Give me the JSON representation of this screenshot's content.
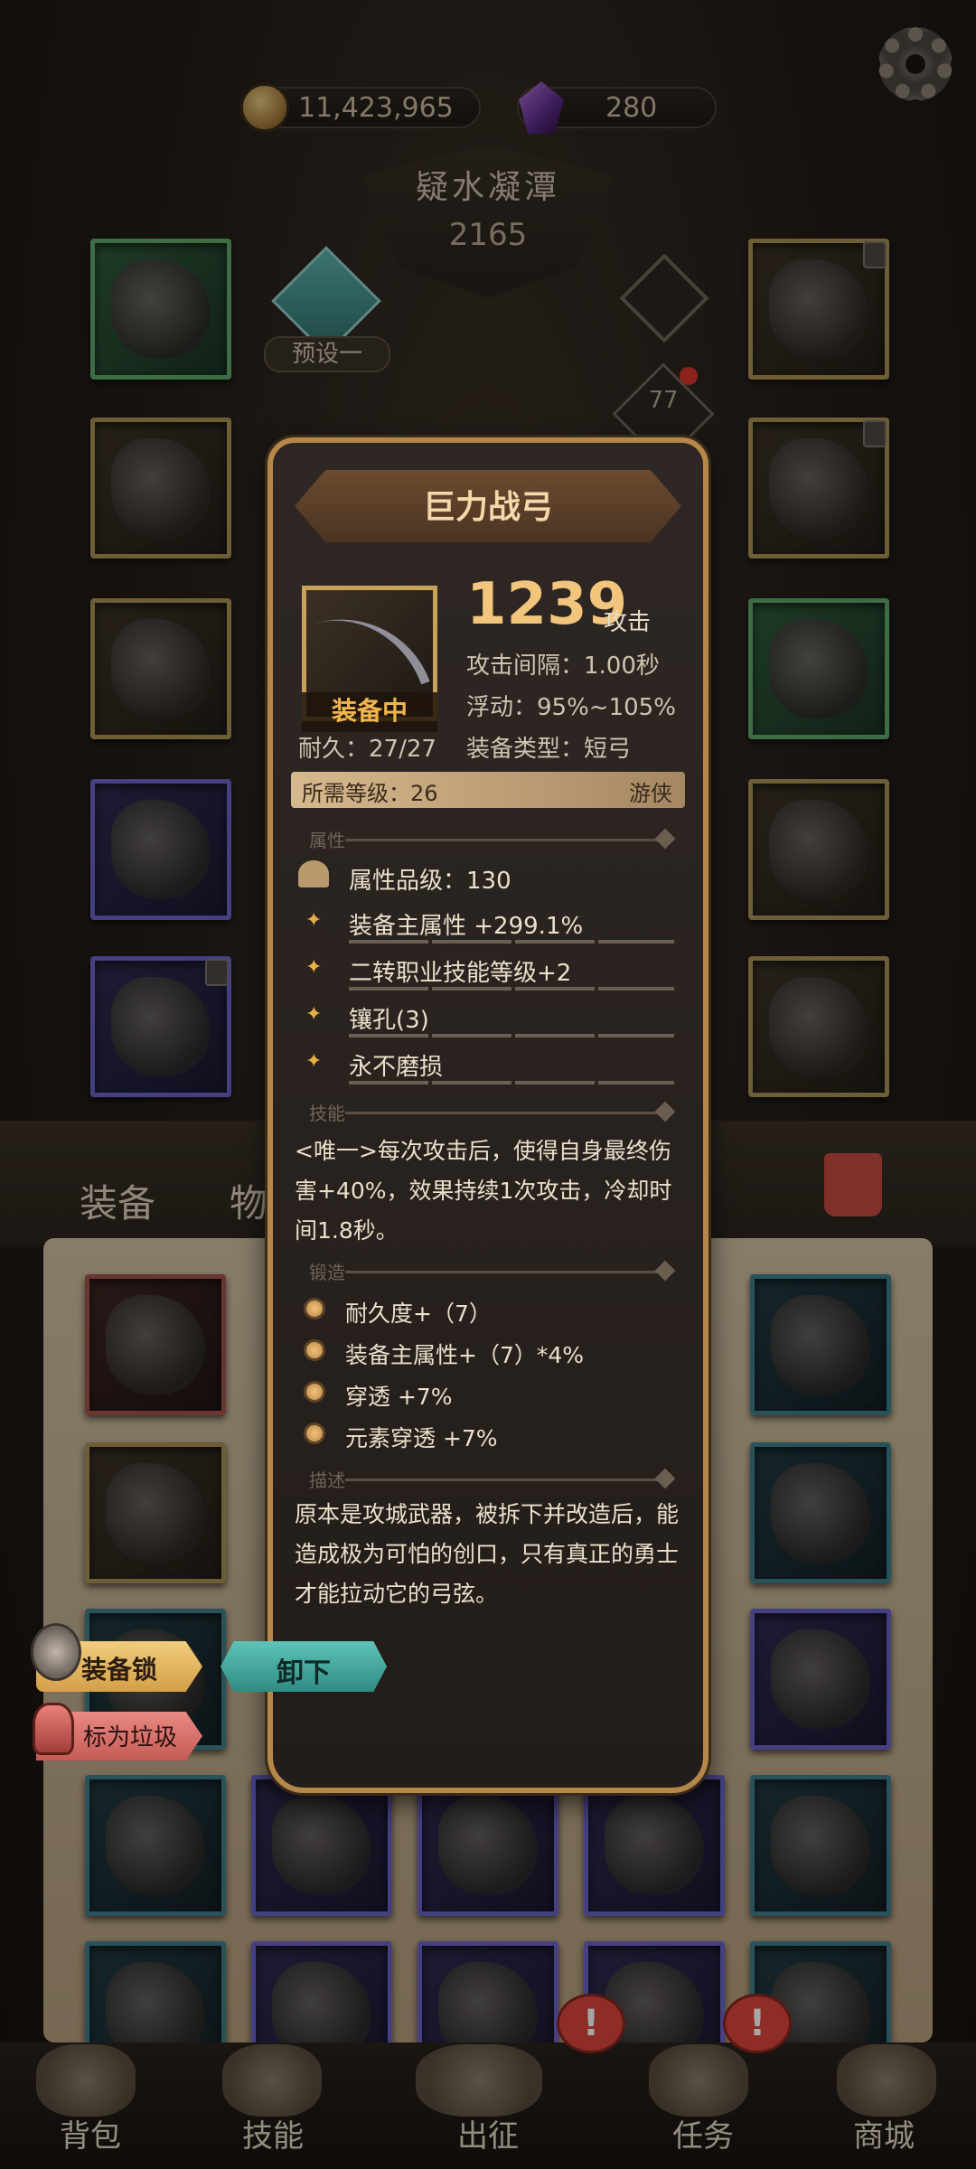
{
  "currency": {
    "gold": "11,423,965",
    "gems": "280"
  },
  "stage": {
    "title": "疑水凝潭",
    "power": "2165"
  },
  "preset": {
    "label": "预设一"
  },
  "level": "77",
  "tabs": {
    "equipment": "装备",
    "items": "物"
  },
  "modal": {
    "title": "巨力战弓",
    "equipped_tag": "装备中",
    "durability": "耐久：27/27",
    "attack_value": "1239",
    "attack_unit": "攻击",
    "attack_interval": "攻击间隔：1.00秒",
    "float": "浮动：95%~105%",
    "equip_type": "装备类型：短弓",
    "required_level": "所需等级：26",
    "class": "游侠",
    "sections": {
      "attributes": "属性",
      "skill": "技能",
      "forge": "锻造",
      "description": "描述"
    },
    "attr_grade": "属性品级：130",
    "attributes": [
      "装备主属性 +299.1%",
      "二转职业技能等级+2",
      "镶孔(3)",
      "永不磨损"
    ],
    "skill_text": "<唯一>每次攻击后，使得自身最终伤害+40%，效果持续1次攻击，冷却时间1.8秒。",
    "forge": [
      "耐久度+（7）",
      "装备主属性+（7）*4%",
      "穿透 +7%",
      "元素穿透 +7%"
    ],
    "description": "原本是攻城武器，被拆下并改造后，能造成极为可怕的创口，只有真正的勇士才能拉动它的弓弦。",
    "buttons": {
      "lock": "装备锁",
      "unequip": "卸下",
      "trash": "标为垃圾"
    }
  },
  "nav": {
    "bag": "背包",
    "skills": "技能",
    "expedition": "出征",
    "quests": "任务",
    "shop": "商城"
  },
  "alerts": {
    "quests": "!",
    "shop": "!"
  }
}
